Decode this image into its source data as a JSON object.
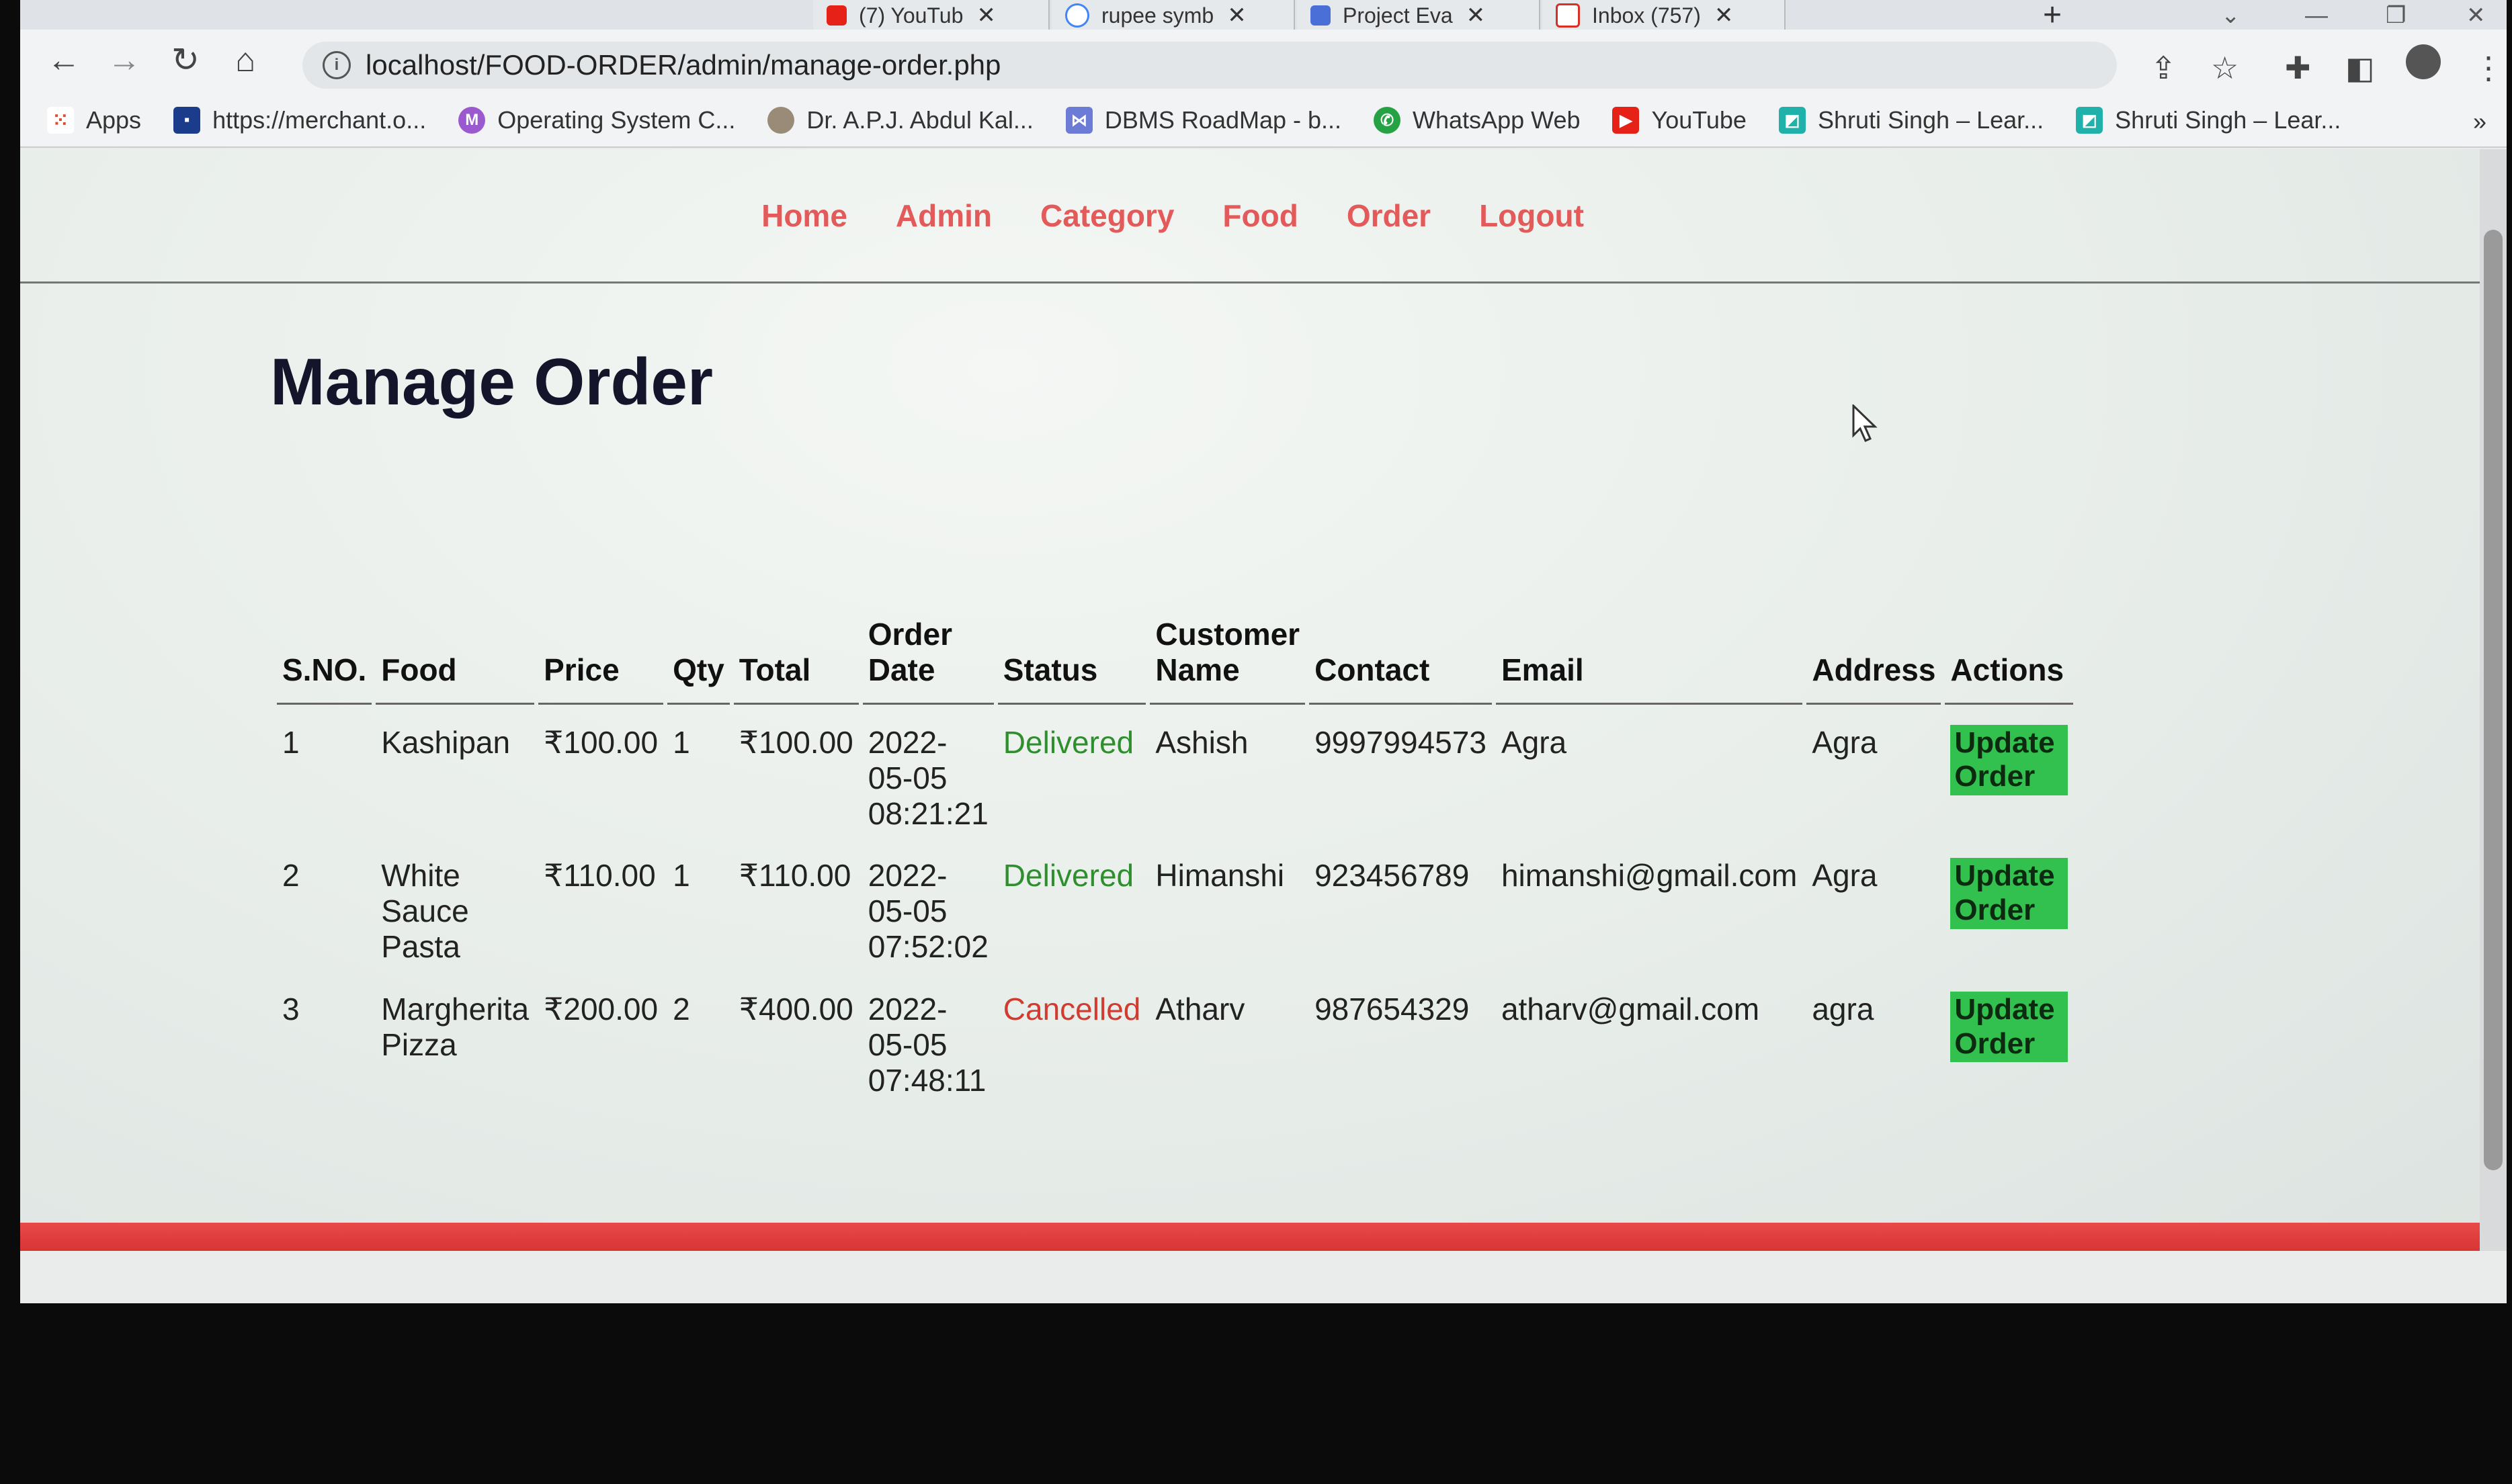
{
  "browser": {
    "tabs": [
      {
        "label": "(7) YouTub"
      },
      {
        "label": "rupee symb"
      },
      {
        "label": "Project Eva"
      },
      {
        "label": "Inbox (757)"
      }
    ],
    "url": "localhost/FOOD-ORDER/admin/manage-order.php",
    "bookmarks": [
      {
        "label": "Apps",
        "icon": "apps-grid-icon"
      },
      {
        "label": "https://merchant.o...",
        "icon": "merchant-icon"
      },
      {
        "label": "Operating System C...",
        "icon": "m-letter-icon"
      },
      {
        "label": "Dr. A.P.J. Abdul Kal...",
        "icon": "portrait-icon"
      },
      {
        "label": "DBMS RoadMap - b...",
        "icon": "roadmap-icon"
      },
      {
        "label": "WhatsApp Web",
        "icon": "whatsapp-icon"
      },
      {
        "label": "YouTube",
        "icon": "youtube-icon"
      },
      {
        "label": "Shruti Singh – Lear...",
        "icon": "bookmark-site-icon"
      },
      {
        "label": "Shruti Singh – Lear...",
        "icon": "bookmark-site-icon"
      }
    ]
  },
  "nav": [
    "Home",
    "Admin",
    "Category",
    "Food",
    "Order",
    "Logout"
  ],
  "title": "Manage Order",
  "table": {
    "headers": [
      "S.NO.",
      "Food",
      "Price",
      "Qty",
      "Total",
      "Order Date",
      "Status",
      "Customer Name",
      "Contact",
      "Email",
      "Address",
      "Actions"
    ],
    "rows": [
      {
        "sno": "1",
        "food": "Kashipan",
        "price": "₹100.00",
        "qty": "1",
        "total": "₹100.00",
        "date": "2022-05-05 08:21:21",
        "status": "Delivered",
        "customer": "Ashish",
        "contact": "9997994573",
        "email": "Agra",
        "address": "Agra",
        "action": "Update Order"
      },
      {
        "sno": "2",
        "food": "White Sauce Pasta",
        "price": "₹110.00",
        "qty": "1",
        "total": "₹110.00",
        "date": "2022-05-05 07:52:02",
        "status": "Delivered",
        "customer": "Himanshi",
        "contact": "923456789",
        "email": "himanshi@gmail.com",
        "address": "Agra",
        "action": "Update Order"
      },
      {
        "sno": "3",
        "food": "Margherita Pizza",
        "price": "₹200.00",
        "qty": "2",
        "total": "₹400.00",
        "date": "2022-05-05 07:48:11",
        "status": "Cancelled",
        "customer": "Atharv",
        "contact": "987654329",
        "email": "atharv@gmail.com",
        "address": "agra",
        "action": "Update Order"
      }
    ]
  },
  "colors": {
    "nav_link": "#e35a5a",
    "delivered": "#2f8f2f",
    "cancelled": "#d23b2f",
    "button": "#32c04f",
    "footer": "#e04040"
  }
}
